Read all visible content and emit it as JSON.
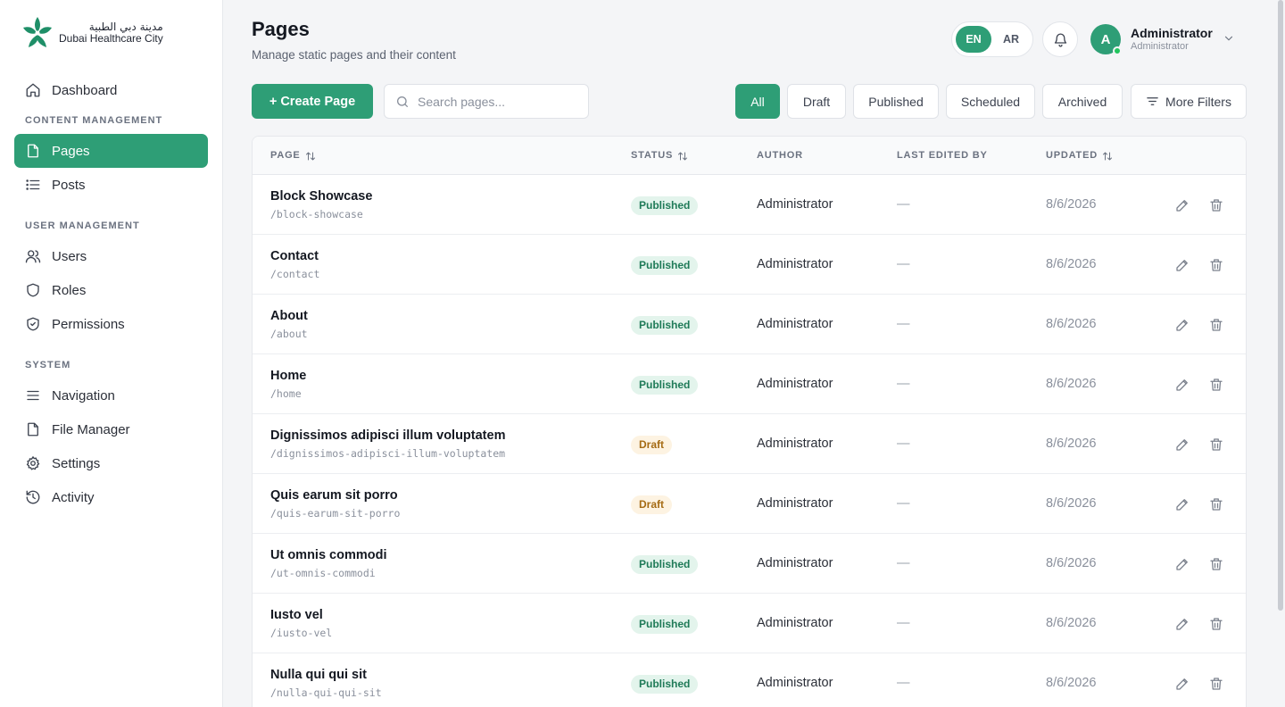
{
  "brand": {
    "logo_ar": "مدينة دبي الطبية",
    "logo_en": "Dubai Healthcare City",
    "accent": "#2e9e76"
  },
  "sidebar": {
    "dashboard": "Dashboard",
    "section_content": "CONTENT MANAGEMENT",
    "pages": "Pages",
    "posts": "Posts",
    "section_user": "USER MANAGEMENT",
    "users": "Users",
    "roles": "Roles",
    "permissions": "Permissions",
    "section_system": "SYSTEM",
    "navigation": "Navigation",
    "file_manager": "File Manager",
    "settings": "Settings",
    "activity": "Activity"
  },
  "header": {
    "title": "Pages",
    "subtitle": "Manage static pages and their content",
    "lang_en": "EN",
    "lang_ar": "AR",
    "user_initial": "A",
    "user_name": "Administrator",
    "user_role": "Administrator"
  },
  "toolbar": {
    "create_label": "+ Create Page",
    "search_placeholder": "Search pages...",
    "filters": {
      "all": "All",
      "draft": "Draft",
      "published": "Published",
      "scheduled": "Scheduled",
      "archived": "Archived",
      "more": "More Filters"
    }
  },
  "table": {
    "headers": {
      "page": "PAGE",
      "status": "STATUS",
      "author": "AUTHOR",
      "last_edited": "LAST EDITED BY",
      "updated": "UPDATED"
    },
    "rows": [
      {
        "title": "Block Showcase",
        "slug": "/block-showcase",
        "status": "Published",
        "author": "Administrator",
        "last_edited": "—",
        "updated": "8/6/2026"
      },
      {
        "title": "Contact",
        "slug": "/contact",
        "status": "Published",
        "author": "Administrator",
        "last_edited": "—",
        "updated": "8/6/2026"
      },
      {
        "title": "About",
        "slug": "/about",
        "status": "Published",
        "author": "Administrator",
        "last_edited": "—",
        "updated": "8/6/2026"
      },
      {
        "title": "Home",
        "slug": "/home",
        "status": "Published",
        "author": "Administrator",
        "last_edited": "—",
        "updated": "8/6/2026"
      },
      {
        "title": "Dignissimos adipisci illum voluptatem",
        "slug": "/dignissimos-adipisci-illum-voluptatem",
        "status": "Draft",
        "author": "Administrator",
        "last_edited": "—",
        "updated": "8/6/2026"
      },
      {
        "title": "Quis earum sit porro",
        "slug": "/quis-earum-sit-porro",
        "status": "Draft",
        "author": "Administrator",
        "last_edited": "—",
        "updated": "8/6/2026"
      },
      {
        "title": "Ut omnis commodi",
        "slug": "/ut-omnis-commodi",
        "status": "Published",
        "author": "Administrator",
        "last_edited": "—",
        "updated": "8/6/2026"
      },
      {
        "title": "Iusto vel",
        "slug": "/iusto-vel",
        "status": "Published",
        "author": "Administrator",
        "last_edited": "—",
        "updated": "8/6/2026"
      },
      {
        "title": "Nulla qui qui sit",
        "slug": "/nulla-qui-qui-sit",
        "status": "Published",
        "author": "Administrator",
        "last_edited": "—",
        "updated": "8/6/2026"
      }
    ]
  }
}
